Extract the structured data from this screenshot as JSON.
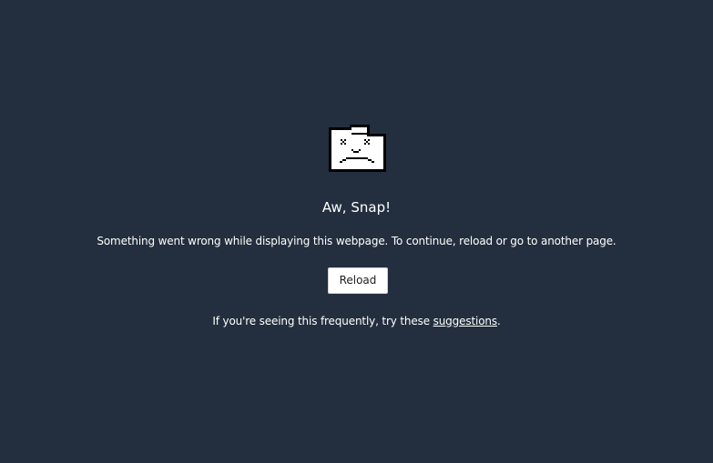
{
  "page": {
    "background_color": "#232f3e"
  },
  "sad_tab": {
    "icon": "sad-folder-icon",
    "title": "Aw, Snap!",
    "message": "Something went wrong while displaying this webpage. To continue, reload or go to another page.",
    "reload_label": "Reload",
    "help_prefix": "If you're seeing this frequently, try these ",
    "help_link": "suggestions",
    "help_suffix": "."
  }
}
